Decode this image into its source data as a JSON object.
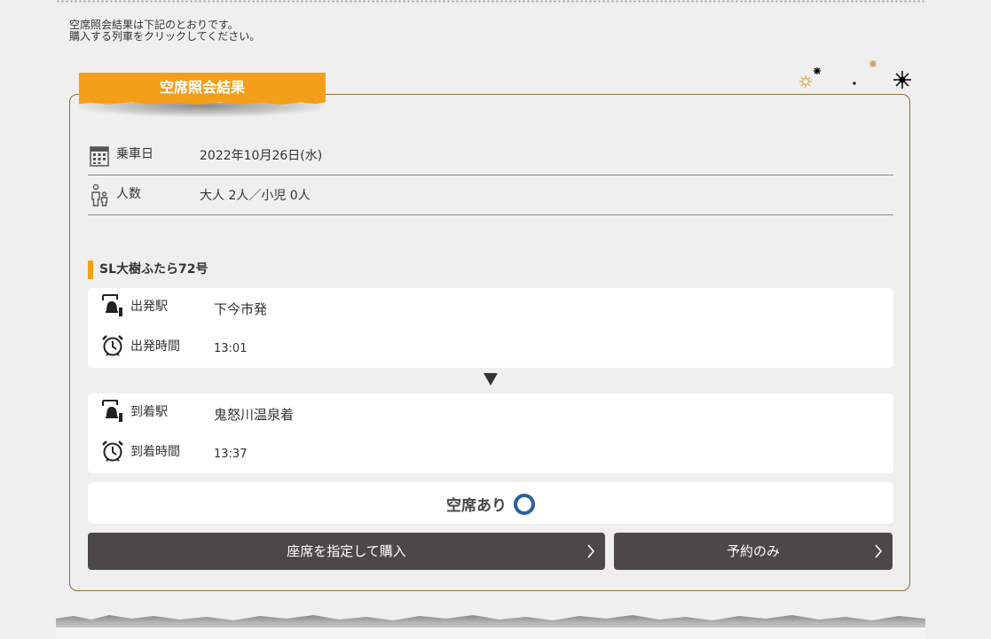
{
  "intro": {
    "line1": "空席照会結果は下記のとおりです。",
    "line2": "購入する列車をクリックしてください。"
  },
  "panel": {
    "title": "空席照会結果",
    "date_label": "乗車日",
    "date_value": "2022年10月26日(水)",
    "people_label": "人数",
    "people_value": "大人 2人／小児 0人"
  },
  "train": {
    "name": "SL大樹ふたら72号",
    "departure_station_label": "出発駅",
    "departure_station": "下今市発",
    "departure_time_label": "出発時間",
    "departure_time": "13:01",
    "arrival_station_label": "到着駅",
    "arrival_station": "鬼怒川温泉着",
    "arrival_time_label": "到着時間",
    "arrival_time": "13:37",
    "availability": "空席あり"
  },
  "buttons": {
    "select_seat_purchase": "座席を指定して購入",
    "reserve_only": "予約のみ"
  },
  "colors": {
    "accent_orange": "#f39f19",
    "panel_border": "#8a7440",
    "button_bg": "#4d4848",
    "availability_circle": "#2d5f9e",
    "page_bg": "#efefef"
  },
  "icons": {
    "calendar": "calendar-icon",
    "people": "people-icon",
    "station": "station-bell-icon",
    "clock": "alarm-clock-icon",
    "chevron": "chevron-right-icon"
  }
}
